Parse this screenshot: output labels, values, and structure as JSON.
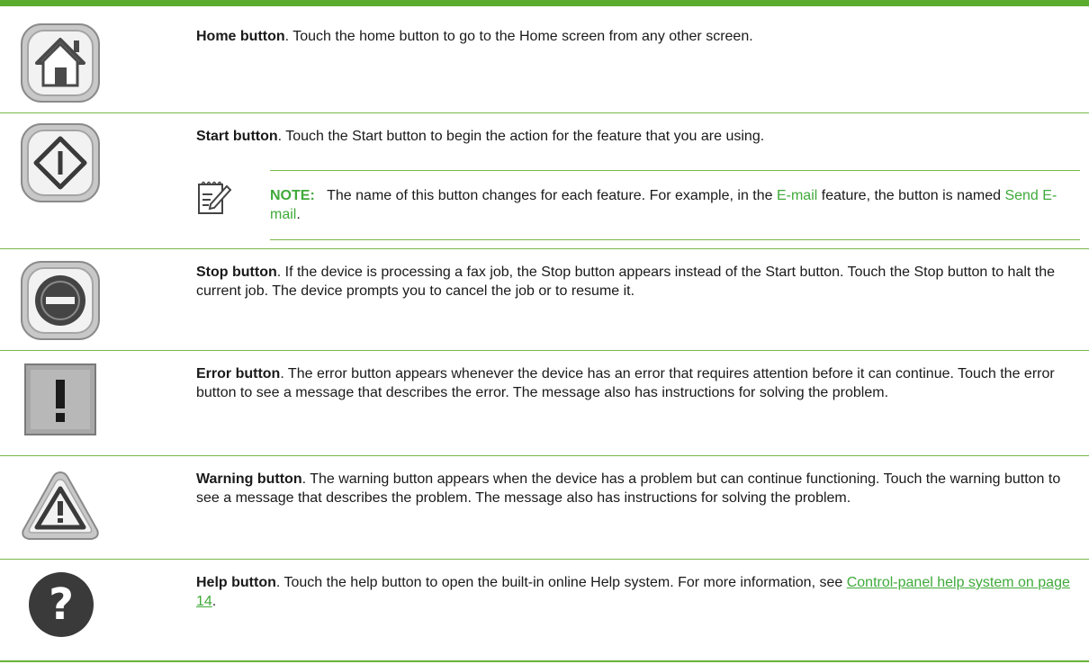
{
  "colors": {
    "accent": "#5aab2e",
    "link": "#3faa3a"
  },
  "rows": [
    {
      "name": "Home button",
      "icon": "home-icon",
      "description": ". Touch the home button to go to the Home screen from any other screen."
    },
    {
      "name": "Start button",
      "icon": "start-diamond-icon",
      "description": ". Touch the Start button to begin the action for the feature that you are using.",
      "note": {
        "icon": "note-pencil-icon",
        "label": "NOTE:",
        "text_1": "The name of this button changes for each feature. For example, in the ",
        "term_1": "E-mail",
        "text_2": " feature, the button is named ",
        "term_2": "Send E-mail",
        "text_3": "."
      }
    },
    {
      "name": "Stop button",
      "icon": "stop-icon",
      "description": ". If the device is processing a fax job, the Stop button appears instead of the Start button. Touch the Stop button to halt the current job. The device prompts you to cancel the job or to resume it."
    },
    {
      "name": "Error button",
      "icon": "error-exclamation-icon",
      "description": ". The error button appears whenever the device has an error that requires attention before it can continue. Touch the error button to see a message that describes the error. The message also has instructions for solving the problem."
    },
    {
      "name": "Warning button",
      "icon": "warning-triangle-icon",
      "description": ". The warning button appears when the device has a problem but can continue functioning. Touch the warning button to see a message that describes the problem. The message also has instructions for solving the problem."
    },
    {
      "name": "Help button",
      "icon": "help-question-icon",
      "description": ". Touch the help button to open the built-in online Help system. For more information, see ",
      "link": "Control-panel help system on page 14",
      "after_link": "."
    }
  ]
}
